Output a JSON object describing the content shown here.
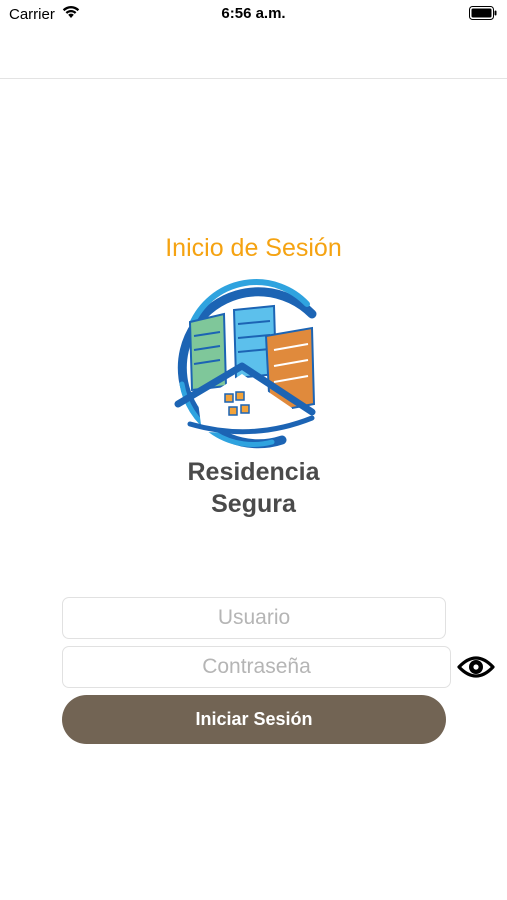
{
  "status_bar": {
    "carrier": "Carrier",
    "time": "6:56 a.m."
  },
  "login": {
    "title": "Inicio de Sesión",
    "brand_line1": "Residencia",
    "brand_line2": "Segura",
    "username_placeholder": "Usuario",
    "password_placeholder": "Contraseña",
    "submit_label": "Iniciar Sesión"
  },
  "icons": {
    "wifi": "wifi-icon",
    "battery": "battery-icon",
    "logo": "residencia-segura-logo",
    "toggle_password": "eye-icon"
  },
  "colors": {
    "title": "#f5a312",
    "button": "#726454",
    "logo_ring_dark": "#1c64b4",
    "logo_ring_light": "#2fa3df",
    "building_green": "#7fc79a",
    "building_blue": "#5cc0ec",
    "building_orange": "#e08a3c"
  }
}
